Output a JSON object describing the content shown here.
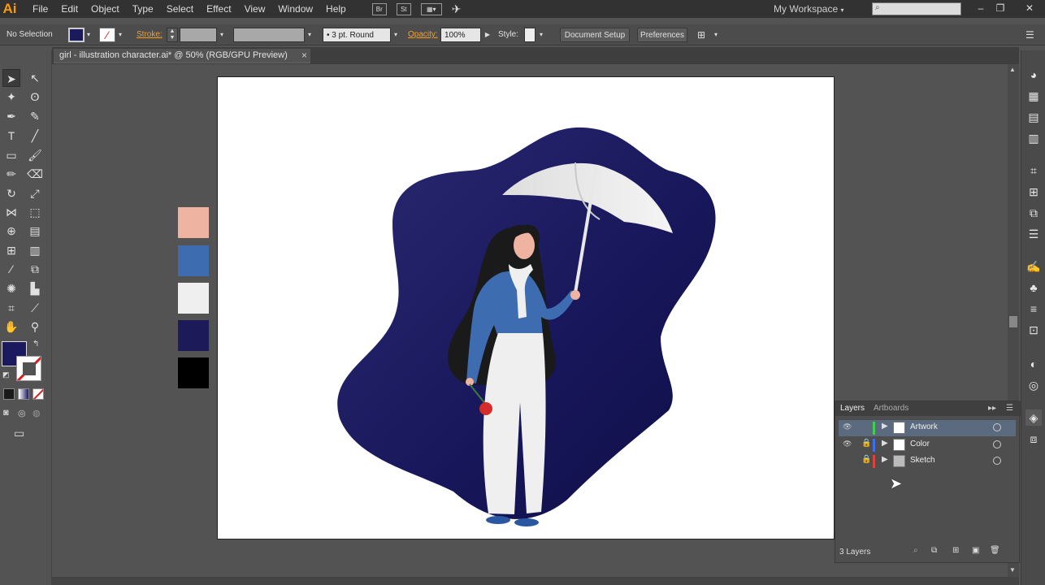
{
  "app": {
    "logo": "Ai"
  },
  "menu": [
    "File",
    "Edit",
    "Object",
    "Type",
    "Select",
    "Effect",
    "View",
    "Window",
    "Help"
  ],
  "menubar_icons": {
    "bridge": "Br",
    "stock": "St"
  },
  "workspace": {
    "label": "My Workspace"
  },
  "window_buttons": {
    "minimize": "–",
    "restore": "❐",
    "close": "✕"
  },
  "control": {
    "selection": "No Selection",
    "stroke_label": "Stroke:",
    "brush": "3 pt. Round",
    "opacity_label": "Opacity:",
    "opacity_value": "100%",
    "style_label": "Style:",
    "document_setup": "Document Setup",
    "preferences": "Preferences"
  },
  "document": {
    "tab_title": "girl - illustration character.ai* @ 50% (RGB/GPU Preview)",
    "close": "×"
  },
  "colors": {
    "fill": "#1b1a5e",
    "swatches": [
      "#efb3a2",
      "#3d6db0",
      "#efefef",
      "#1c1a58",
      "#000000"
    ]
  },
  "layers_panel": {
    "tabs": [
      "Layers",
      "Artboards"
    ],
    "layers": [
      {
        "name": "Artwork",
        "color": "#3fd04c",
        "selected": true,
        "visible": true,
        "locked": false
      },
      {
        "name": "Color",
        "color": "#3b6ef0",
        "selected": false,
        "visible": true,
        "locked": true
      },
      {
        "name": "Sketch",
        "color": "#e04040",
        "selected": false,
        "visible": false,
        "locked": true
      }
    ],
    "count": "3 Layers"
  }
}
